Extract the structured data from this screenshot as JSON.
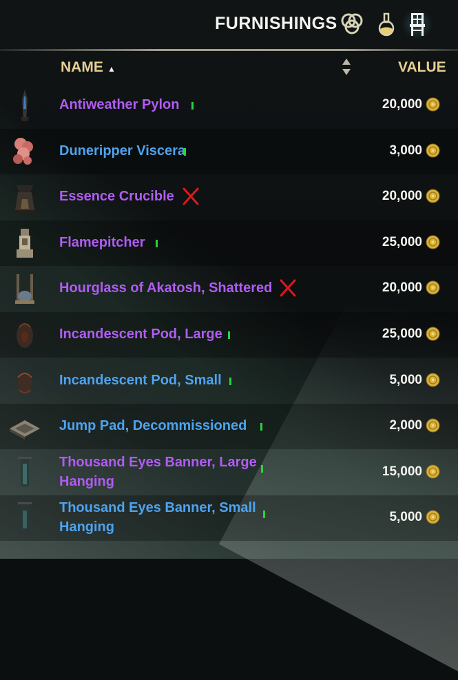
{
  "header": {
    "title": "FURNISHINGS",
    "icons": [
      "crafting-stations-icon",
      "consumables-flask-icon",
      "chair-furnishing-icon"
    ]
  },
  "columns": {
    "name": "NAME",
    "value": "VALUE"
  },
  "colors": {
    "purple_quality": "#b05cf2",
    "blue_quality": "#4da3f0",
    "ok_mark": "#27d63a",
    "x_mark": "#e3161c",
    "gold": "#d9b23a"
  },
  "items": [
    {
      "name": "Antiweather Pylon",
      "value": "20,000",
      "quality": "purple",
      "mark": "ok",
      "icon": "pylon-icon"
    },
    {
      "name": "Duneripper Viscera",
      "value": "3,000",
      "quality": "blue",
      "mark": "ok",
      "icon": "viscera-icon"
    },
    {
      "name": "Essence Crucible",
      "value": "20,000",
      "quality": "purple",
      "mark": "x",
      "icon": "crucible-icon"
    },
    {
      "name": "Flamepitcher",
      "value": "25,000",
      "quality": "purple",
      "mark": "ok",
      "icon": "flamepitcher-icon"
    },
    {
      "name": "Hourglass of Akatosh, Shattered",
      "value": "20,000",
      "quality": "purple",
      "mark": "x",
      "icon": "hourglass-icon"
    },
    {
      "name": "Incandescent Pod, Large",
      "value": "25,000",
      "quality": "purple",
      "mark": "ok",
      "icon": "pod-large-icon"
    },
    {
      "name": "Incandescent Pod, Small",
      "value": "5,000",
      "quality": "blue",
      "mark": "ok",
      "icon": "pod-small-icon"
    },
    {
      "name": "Jump Pad, Decommissioned",
      "value": "2,000",
      "quality": "blue",
      "mark": "ok",
      "icon": "jump-pad-icon"
    },
    {
      "name": "Thousand Eyes Banner, Large Hanging",
      "name_lines": [
        "Thousand Eyes Banner, Large",
        "Hanging"
      ],
      "value": "15,000",
      "quality": "purple",
      "mark": "ok",
      "icon": "banner-large-icon"
    },
    {
      "name": "Thousand Eyes Banner, Small Hanging",
      "name_lines": [
        "Thousand Eyes Banner, Small",
        "Hanging"
      ],
      "value": "5,000",
      "quality": "blue",
      "mark": "ok",
      "icon": "banner-small-icon"
    }
  ]
}
